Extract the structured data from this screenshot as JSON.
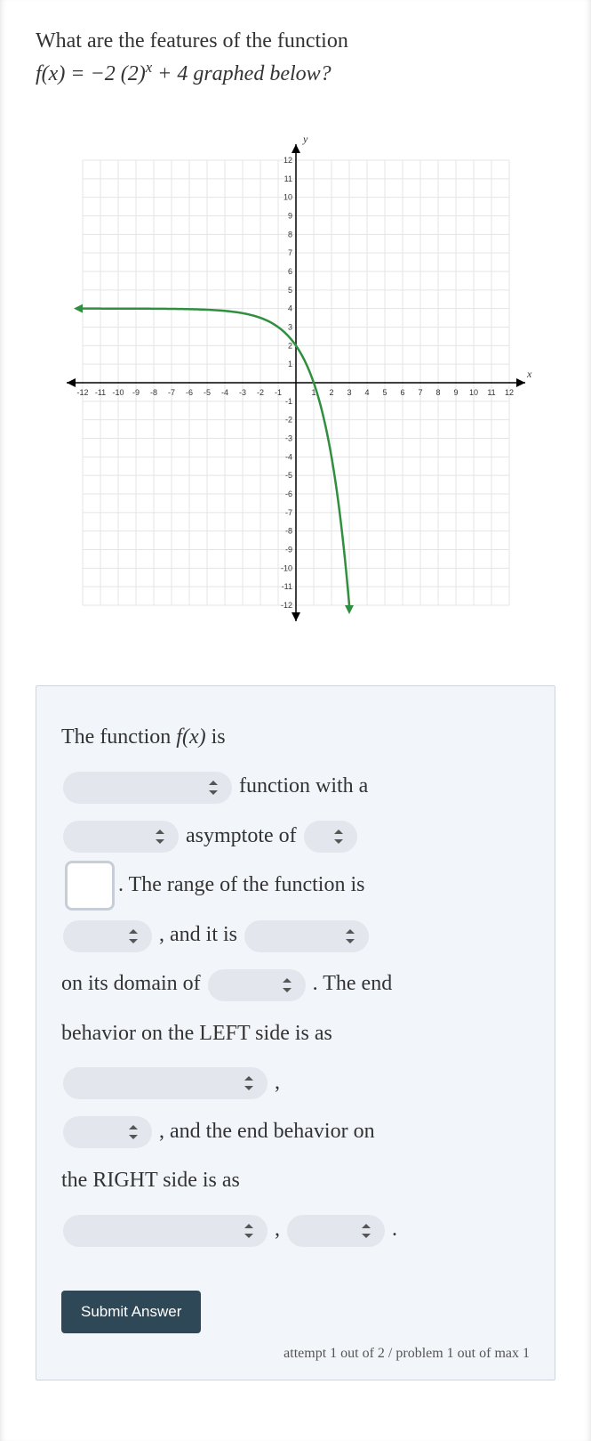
{
  "question": {
    "line1": "What are the features of the function",
    "line2_prefix": "f(x) = −2 (2)",
    "line2_exp": "x",
    "line2_suffix": " + 4 graphed below?"
  },
  "chart_data": {
    "type": "line",
    "title": "",
    "xlabel": "x",
    "ylabel": "y",
    "xlim": [
      -12,
      12
    ],
    "ylim": [
      -12,
      12
    ],
    "x_ticks": [
      -12,
      -11,
      -10,
      -9,
      -8,
      -7,
      -6,
      -5,
      -4,
      -3,
      -2,
      -1,
      1,
      2,
      3,
      4,
      5,
      6,
      7,
      8,
      9,
      10,
      11,
      12
    ],
    "y_ticks": [
      -12,
      -11,
      -10,
      -9,
      -8,
      -7,
      -6,
      -5,
      -4,
      -3,
      -2,
      -1,
      1,
      2,
      3,
      4,
      5,
      6,
      7,
      8,
      9,
      10,
      11,
      12
    ],
    "series": [
      {
        "name": "f(x) = -2(2)^x + 4",
        "color": "#2f8f3f",
        "x": [
          -12,
          -10,
          -8,
          -6,
          -4,
          -2,
          -1,
          0,
          1,
          2,
          3
        ],
        "values": [
          4.0,
          4.0,
          3.99,
          3.97,
          3.88,
          3.5,
          3,
          2,
          0,
          -4,
          -12
        ]
      }
    ],
    "asymptote": {
      "axis": "y",
      "value": 4
    },
    "grid": true
  },
  "answer": {
    "t1": "The function ",
    "fx": "f(x)",
    "t1b": " is",
    "t2": " function with a",
    "t3": " asymptote of ",
    "t4": ". The range of the function is",
    "t5": " , and it is ",
    "t6": "on its domain of ",
    "t7": " . The end",
    "t8": "behavior on the LEFT side is as",
    "t9": " ,",
    "t10": " , and the end behavior on",
    "t11": "the RIGHT side is as",
    "t12": " ,",
    "t13": " ."
  },
  "submit": "Submit Answer",
  "attempt": "attempt 1 out of 2 / problem 1 out of max 1"
}
